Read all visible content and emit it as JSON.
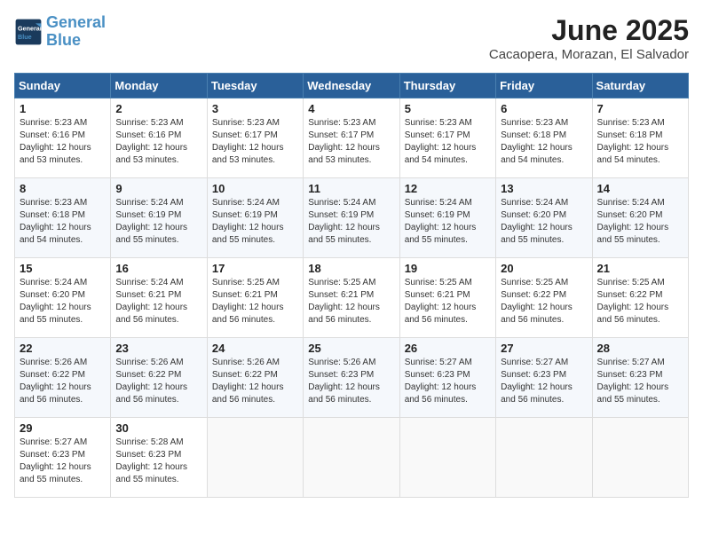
{
  "logo": {
    "line1": "General",
    "line2": "Blue"
  },
  "title": "June 2025",
  "location": "Cacaopera, Morazan, El Salvador",
  "days_of_week": [
    "Sunday",
    "Monday",
    "Tuesday",
    "Wednesday",
    "Thursday",
    "Friday",
    "Saturday"
  ],
  "weeks": [
    [
      {
        "day": "1",
        "sunrise": "5:23 AM",
        "sunset": "6:16 PM",
        "daylight": "12 hours and 53 minutes."
      },
      {
        "day": "2",
        "sunrise": "5:23 AM",
        "sunset": "6:16 PM",
        "daylight": "12 hours and 53 minutes."
      },
      {
        "day": "3",
        "sunrise": "5:23 AM",
        "sunset": "6:17 PM",
        "daylight": "12 hours and 53 minutes."
      },
      {
        "day": "4",
        "sunrise": "5:23 AM",
        "sunset": "6:17 PM",
        "daylight": "12 hours and 53 minutes."
      },
      {
        "day": "5",
        "sunrise": "5:23 AM",
        "sunset": "6:17 PM",
        "daylight": "12 hours and 54 minutes."
      },
      {
        "day": "6",
        "sunrise": "5:23 AM",
        "sunset": "6:18 PM",
        "daylight": "12 hours and 54 minutes."
      },
      {
        "day": "7",
        "sunrise": "5:23 AM",
        "sunset": "6:18 PM",
        "daylight": "12 hours and 54 minutes."
      }
    ],
    [
      {
        "day": "8",
        "sunrise": "5:23 AM",
        "sunset": "6:18 PM",
        "daylight": "12 hours and 54 minutes."
      },
      {
        "day": "9",
        "sunrise": "5:24 AM",
        "sunset": "6:19 PM",
        "daylight": "12 hours and 55 minutes."
      },
      {
        "day": "10",
        "sunrise": "5:24 AM",
        "sunset": "6:19 PM",
        "daylight": "12 hours and 55 minutes."
      },
      {
        "day": "11",
        "sunrise": "5:24 AM",
        "sunset": "6:19 PM",
        "daylight": "12 hours and 55 minutes."
      },
      {
        "day": "12",
        "sunrise": "5:24 AM",
        "sunset": "6:19 PM",
        "daylight": "12 hours and 55 minutes."
      },
      {
        "day": "13",
        "sunrise": "5:24 AM",
        "sunset": "6:20 PM",
        "daylight": "12 hours and 55 minutes."
      },
      {
        "day": "14",
        "sunrise": "5:24 AM",
        "sunset": "6:20 PM",
        "daylight": "12 hours and 55 minutes."
      }
    ],
    [
      {
        "day": "15",
        "sunrise": "5:24 AM",
        "sunset": "6:20 PM",
        "daylight": "12 hours and 55 minutes."
      },
      {
        "day": "16",
        "sunrise": "5:24 AM",
        "sunset": "6:21 PM",
        "daylight": "12 hours and 56 minutes."
      },
      {
        "day": "17",
        "sunrise": "5:25 AM",
        "sunset": "6:21 PM",
        "daylight": "12 hours and 56 minutes."
      },
      {
        "day": "18",
        "sunrise": "5:25 AM",
        "sunset": "6:21 PM",
        "daylight": "12 hours and 56 minutes."
      },
      {
        "day": "19",
        "sunrise": "5:25 AM",
        "sunset": "6:21 PM",
        "daylight": "12 hours and 56 minutes."
      },
      {
        "day": "20",
        "sunrise": "5:25 AM",
        "sunset": "6:22 PM",
        "daylight": "12 hours and 56 minutes."
      },
      {
        "day": "21",
        "sunrise": "5:25 AM",
        "sunset": "6:22 PM",
        "daylight": "12 hours and 56 minutes."
      }
    ],
    [
      {
        "day": "22",
        "sunrise": "5:26 AM",
        "sunset": "6:22 PM",
        "daylight": "12 hours and 56 minutes."
      },
      {
        "day": "23",
        "sunrise": "5:26 AM",
        "sunset": "6:22 PM",
        "daylight": "12 hours and 56 minutes."
      },
      {
        "day": "24",
        "sunrise": "5:26 AM",
        "sunset": "6:22 PM",
        "daylight": "12 hours and 56 minutes."
      },
      {
        "day": "25",
        "sunrise": "5:26 AM",
        "sunset": "6:23 PM",
        "daylight": "12 hours and 56 minutes."
      },
      {
        "day": "26",
        "sunrise": "5:27 AM",
        "sunset": "6:23 PM",
        "daylight": "12 hours and 56 minutes."
      },
      {
        "day": "27",
        "sunrise": "5:27 AM",
        "sunset": "6:23 PM",
        "daylight": "12 hours and 56 minutes."
      },
      {
        "day": "28",
        "sunrise": "5:27 AM",
        "sunset": "6:23 PM",
        "daylight": "12 hours and 55 minutes."
      }
    ],
    [
      {
        "day": "29",
        "sunrise": "5:27 AM",
        "sunset": "6:23 PM",
        "daylight": "12 hours and 55 minutes."
      },
      {
        "day": "30",
        "sunrise": "5:28 AM",
        "sunset": "6:23 PM",
        "daylight": "12 hours and 55 minutes."
      },
      null,
      null,
      null,
      null,
      null
    ]
  ],
  "labels": {
    "sunrise_prefix": "Sunrise: ",
    "sunset_prefix": "Sunset: ",
    "daylight_prefix": "Daylight: "
  }
}
